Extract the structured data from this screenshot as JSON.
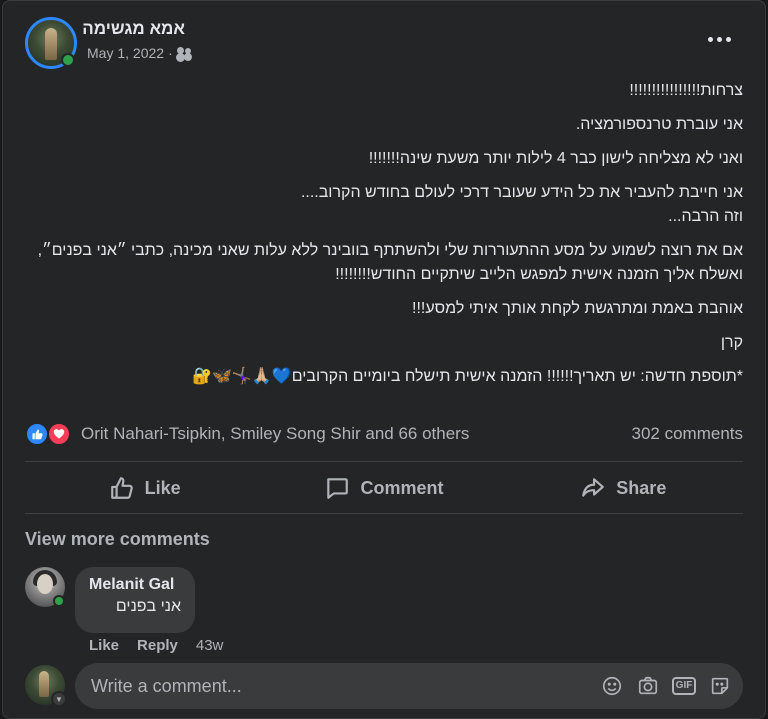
{
  "post": {
    "author": "אמא מגשימה",
    "date": "May 1, 2022",
    "separator": "·",
    "audience_icon": "friends-icon",
    "paragraphs": [
      "צרחות!!!!!!!!!!!!!!!!",
      "אני עוברת טרנספורמציה.",
      "ואני לא מצליחה לישון כבר 4 לילות יותר משעת שינה!!!!!!!",
      "אני חייבת להעביר את כל הידע שעובר דרכי לעולם בחודש הקרוב....",
      "וזה הרבה...",
      "אם את רוצה לשמוע על מסע ההתעוררות שלי ולהשתתף בוובינר ללא עלות שאני מכינה,  כתבי ״אני בפנים״, ואשלח אליך הזמנה אישית למפגש הלייב שיתקיים החודש!!!!!!!!",
      "אוהבת באמת ומתרגשת לקחת אותך איתי למסע!!!",
      "קרן",
      "*תוספת חדשה: יש תאריך!!!!!! הזמנה אישית תישלח ביומיים הקרובים💙🙏🏼🤸🏽‍♀️🦋🔐"
    ]
  },
  "reactions": {
    "names": "Orit Nahari-Tsipkin, Smiley Song Shir and 66 others",
    "comments": "302 comments"
  },
  "actions": {
    "like": "Like",
    "comment": "Comment",
    "share": "Share"
  },
  "view_more": "View more comments",
  "comment": {
    "author": "Melanit Gal",
    "text": "אני בפנים",
    "like": "Like",
    "reply": "Reply",
    "time": "43w"
  },
  "composer": {
    "placeholder": "Write a comment...",
    "gif_label": "GIF"
  },
  "colors": {
    "background": "#242526",
    "accent": "#2d88ff",
    "love": "#f33e58",
    "online": "#31a24c"
  }
}
